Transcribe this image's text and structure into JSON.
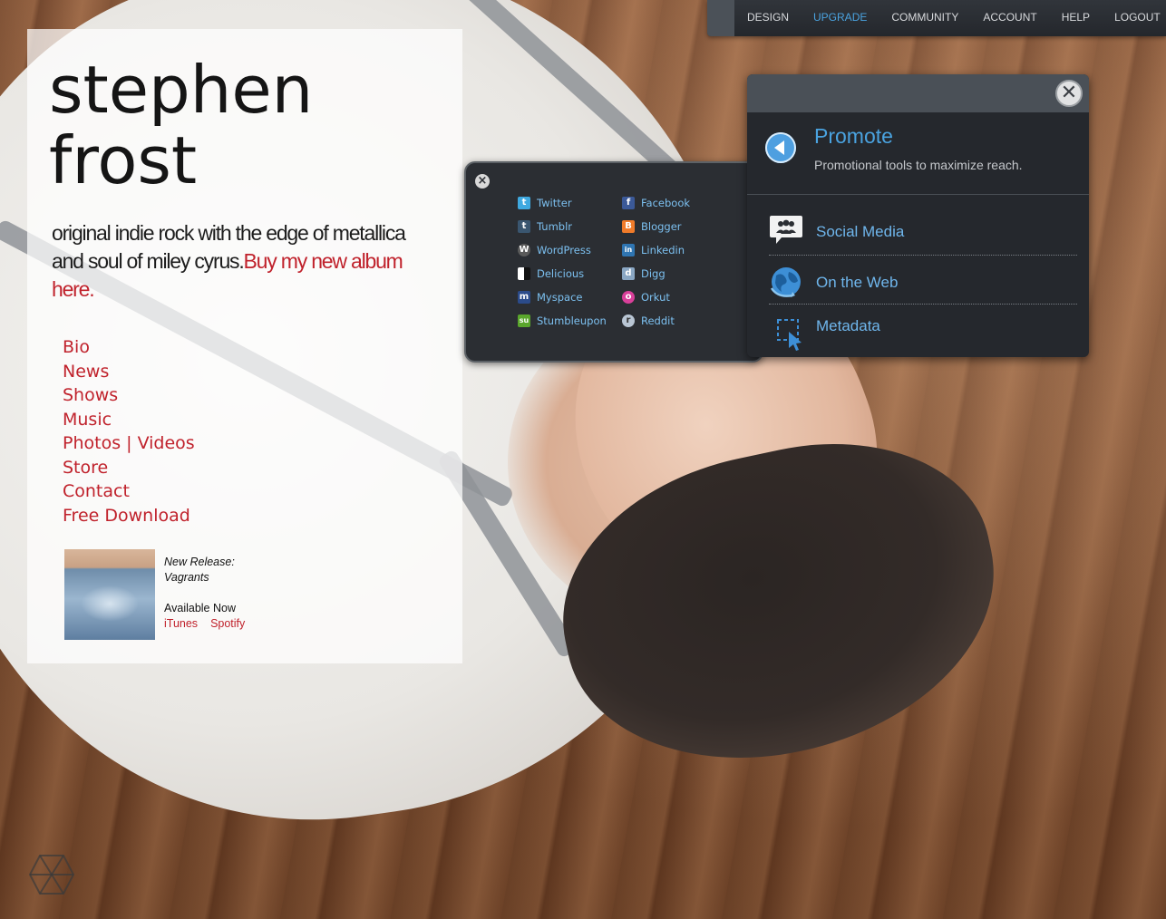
{
  "site": {
    "artist_line1": "stephen",
    "artist_line2": "frost",
    "tagline": "original indie rock with the edge of metallica and soul of miley cyrus.",
    "tagline_link": "Buy my new album here.",
    "nav": [
      "Bio",
      "News",
      "Shows",
      "Music",
      "Photos | Videos",
      "Store",
      "Contact",
      "Free Download"
    ],
    "release": {
      "label": "New Release:",
      "title": "Vagrants",
      "availability": "Available Now",
      "links": [
        "iTunes",
        "Spotify"
      ]
    }
  },
  "topnav": {
    "items": [
      "DESIGN",
      "UPGRADE",
      "COMMUNITY",
      "ACCOUNT",
      "HELP",
      "LOGOUT"
    ],
    "active": "UPGRADE"
  },
  "social": {
    "items": [
      {
        "label": "Twitter",
        "icon": "twitter-icon",
        "color": "#3fa9e0",
        "glyph": "t"
      },
      {
        "label": "Facebook",
        "icon": "facebook-icon",
        "color": "#3b5998",
        "glyph": "f"
      },
      {
        "label": "Tumblr",
        "icon": "tumblr-icon",
        "color": "#3a5670",
        "glyph": "t"
      },
      {
        "label": "Blogger",
        "icon": "blogger-icon",
        "color": "#f07b2a",
        "glyph": "B"
      },
      {
        "label": "WordPress",
        "icon": "wordpress-icon",
        "color": "#5a5a5a",
        "glyph": "W"
      },
      {
        "label": "Linkedin",
        "icon": "linkedin-icon",
        "color": "#2f75b2",
        "glyph": "in"
      },
      {
        "label": "Delicious",
        "icon": "delicious-icon",
        "color": "#d9d9d9",
        "glyph": ""
      },
      {
        "label": "Digg",
        "icon": "digg-icon",
        "color": "#8aa7c4",
        "glyph": "d"
      },
      {
        "label": "Myspace",
        "icon": "myspace-icon",
        "color": "#2b4b8a",
        "glyph": "m"
      },
      {
        "label": "Orkut",
        "icon": "orkut-icon",
        "color": "#d9409a",
        "glyph": "o"
      },
      {
        "label": "Stumbleupon",
        "icon": "stumbleupon-icon",
        "color": "#5aa62c",
        "glyph": "su"
      },
      {
        "label": "Reddit",
        "icon": "reddit-icon",
        "color": "#b9c6d4",
        "glyph": "r"
      }
    ]
  },
  "promote": {
    "title": "Promote",
    "subtitle": "Promotional tools to maximize reach.",
    "menu": [
      {
        "label": "Social Media",
        "icon": "social-media-icon"
      },
      {
        "label": "On the Web",
        "icon": "globe-icon"
      },
      {
        "label": "Metadata",
        "icon": "metadata-cursor-icon"
      }
    ]
  },
  "colors": {
    "accent_red": "#c0222c",
    "accent_blue": "#4aa3e0",
    "dark_panel": "#25282d"
  }
}
